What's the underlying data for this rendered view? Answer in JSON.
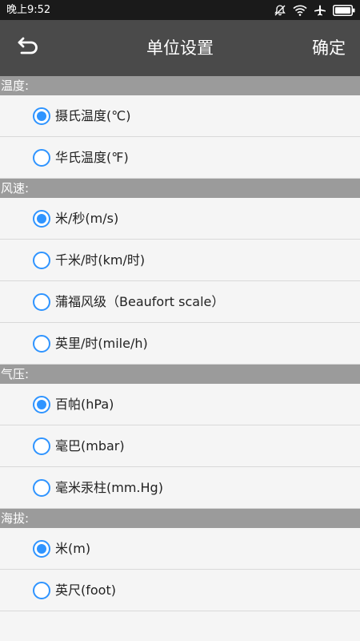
{
  "status_bar": {
    "time": "晚上9:52",
    "icons": [
      "mute-icon",
      "wifi-icon",
      "airplane-icon",
      "battery-icon"
    ]
  },
  "header": {
    "back_icon": "back-arrow-icon",
    "title": "单位设置",
    "confirm_label": "确定"
  },
  "colors": {
    "status_bar_bg": "#1a1a1a",
    "app_bar_bg": "#4a4a4a",
    "section_header_bg": "#9b9b9b",
    "radio_accent": "#2f94ff",
    "page_bg": "#f5f5f5"
  },
  "sections": [
    {
      "title": "温度:",
      "options": [
        {
          "label": "摄氏温度(℃)",
          "selected": true
        },
        {
          "label": "华氏温度(℉)",
          "selected": false
        }
      ]
    },
    {
      "title": "风速:",
      "options": [
        {
          "label": "米/秒(m/s)",
          "selected": true
        },
        {
          "label": "千米/时(km/时)",
          "selected": false
        },
        {
          "label": "蒲福风级（Beaufort scale）",
          "selected": false
        },
        {
          "label": "英里/时(mile/h)",
          "selected": false
        }
      ]
    },
    {
      "title": "气压:",
      "options": [
        {
          "label": "百帕(hPa)",
          "selected": true
        },
        {
          "label": "毫巴(mbar)",
          "selected": false
        },
        {
          "label": "毫米汞柱(mm.Hg)",
          "selected": false
        }
      ]
    },
    {
      "title": "海拔:",
      "options": [
        {
          "label": "米(m)",
          "selected": true
        },
        {
          "label": "英尺(foot)",
          "selected": false
        }
      ]
    }
  ]
}
